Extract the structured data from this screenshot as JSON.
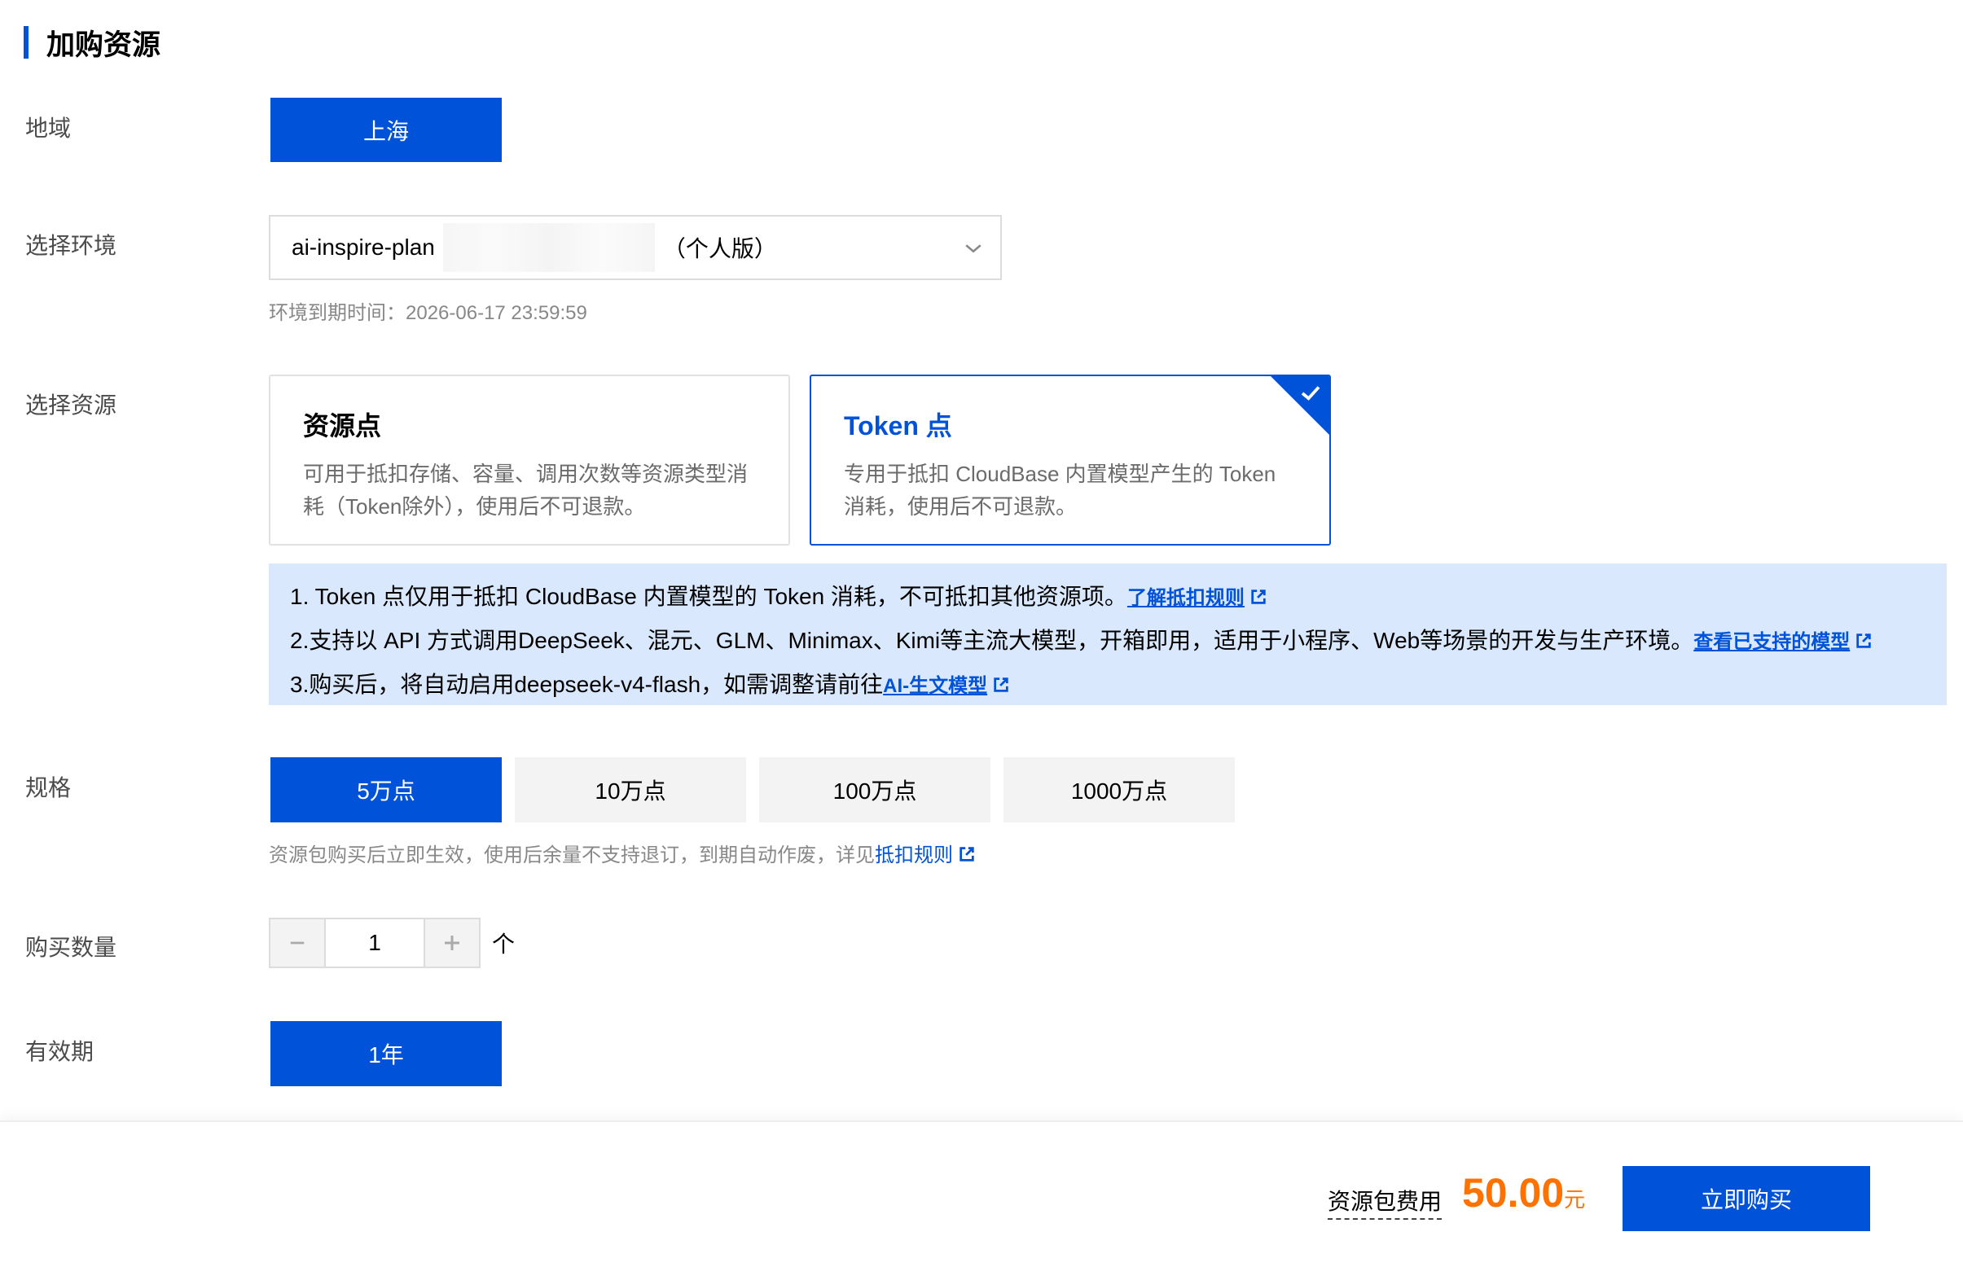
{
  "section": {
    "title": "加购资源"
  },
  "region": {
    "label": "地域",
    "value": "上海"
  },
  "environment": {
    "label": "选择环境",
    "value_prefix": "ai-inspire-plan",
    "value_suffix": "（个人版）",
    "expire_hint": "环境到期时间：2026-06-17 23:59:59"
  },
  "resource": {
    "label": "选择资源",
    "cards": [
      {
        "title": "资源点",
        "desc": "可用于抵扣存储、容量、调用次数等资源类型消耗（Token除外），使用后不可退款。",
        "selected": false
      },
      {
        "title": "Token 点",
        "desc": "专用于抵扣 CloudBase 内置模型产生的 Token 消耗，使用后不可退款。",
        "selected": true
      }
    ]
  },
  "notice": {
    "line1": "1. Token 点仅用于抵扣 CloudBase 内置模型的 Token 消耗，不可抵扣其他资源项。",
    "link1": "了解抵扣规则",
    "line2": "2.支持以 API 方式调用DeepSeek、混元、GLM、Minimax、Kimi等主流大模型，开箱即用，适用于小程序、Web等场景的开发与生产环境。",
    "link2": "查看已支持的模型",
    "line3": "3.购买后，将自动启用deepseek-v4-flash，如需调整请前往",
    "link3": "AI-生文模型"
  },
  "spec": {
    "label": "规格",
    "options": [
      "5万点",
      "10万点",
      "100万点",
      "1000万点"
    ],
    "selected_index": 0,
    "hint": "资源包购买后立即生效，使用后余量不支持退订，到期自动作废，详见",
    "hint_link": "抵扣规则"
  },
  "quantity": {
    "label": "购买数量",
    "value": "1",
    "unit": "个"
  },
  "validity": {
    "label": "有效期",
    "value": "1年"
  },
  "footer": {
    "fee_label": "资源包费用",
    "amount": "50.00",
    "currency": "元",
    "buy_label": "立即购买"
  },
  "colors": {
    "primary": "#0052d9",
    "price": "#ff7200",
    "notice_bg": "#d9e8fd"
  }
}
